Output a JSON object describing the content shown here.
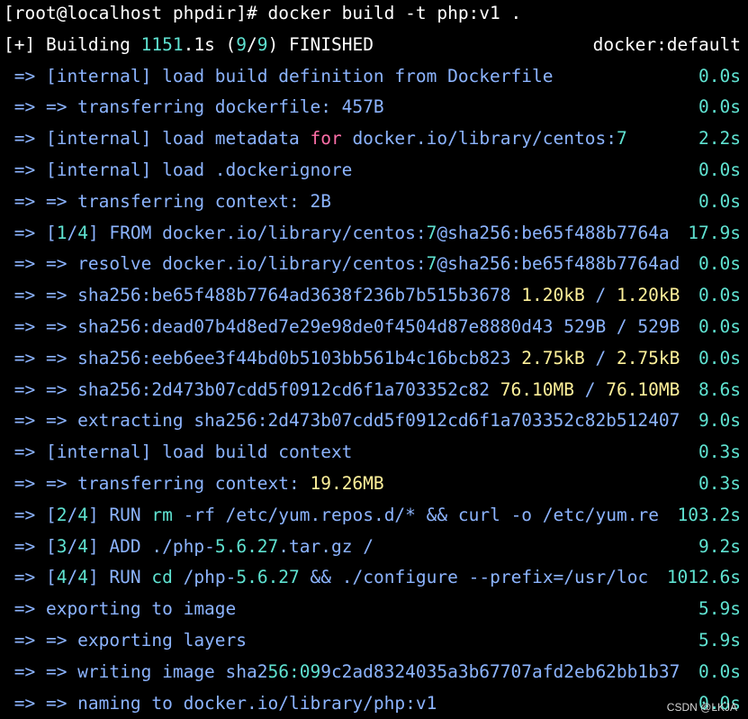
{
  "colors": {
    "default": "#ffffff",
    "blue": "#8cb4ff",
    "cyan": "#5fe2d1",
    "yellow": "#fff19a",
    "pink": "#ff6fa8"
  },
  "watermark": "CSDN @LKJA",
  "lines": [
    {
      "segments": [
        {
          "text": "[root@localhost phpdir]# docker build -t php:v1 .",
          "color": "default"
        }
      ],
      "right": []
    },
    {
      "segments": [
        {
          "text": "[+] Building ",
          "color": "default"
        },
        {
          "text": "1151",
          "color": "cyan"
        },
        {
          "text": ".1s (",
          "color": "default"
        },
        {
          "text": "9",
          "color": "cyan"
        },
        {
          "text": "/",
          "color": "default"
        },
        {
          "text": "9",
          "color": "cyan"
        },
        {
          "text": ") FINISHED",
          "color": "default"
        }
      ],
      "right": [
        {
          "text": "docker:default",
          "color": "default"
        }
      ]
    },
    {
      "segments": [
        {
          "text": " => [internal] load build definition from Dockerfile",
          "color": "blue"
        }
      ],
      "right": [
        {
          "text": "0.0s",
          "color": "cyan"
        }
      ]
    },
    {
      "segments": [
        {
          "text": " => => transferring dockerfile: 457B",
          "color": "blue"
        }
      ],
      "right": [
        {
          "text": "0.0s",
          "color": "cyan"
        }
      ]
    },
    {
      "segments": [
        {
          "text": " => [internal] load metadata ",
          "color": "blue"
        },
        {
          "text": "for",
          "color": "pink"
        },
        {
          "text": " docker.io/library/centos:",
          "color": "blue"
        },
        {
          "text": "7",
          "color": "cyan"
        }
      ],
      "right": [
        {
          "text": "2.2s",
          "color": "cyan"
        }
      ]
    },
    {
      "segments": [
        {
          "text": " => [internal] load .dockerignore",
          "color": "blue"
        }
      ],
      "right": [
        {
          "text": "0.0s",
          "color": "cyan"
        }
      ]
    },
    {
      "segments": [
        {
          "text": " => => transferring context: 2B",
          "color": "blue"
        }
      ],
      "right": [
        {
          "text": "0.0s",
          "color": "cyan"
        }
      ]
    },
    {
      "segments": [
        {
          "text": " => [",
          "color": "blue"
        },
        {
          "text": "1",
          "color": "cyan"
        },
        {
          "text": "/",
          "color": "blue"
        },
        {
          "text": "4",
          "color": "cyan"
        },
        {
          "text": "] FROM docker.io/library/centos:",
          "color": "blue"
        },
        {
          "text": "7",
          "color": "cyan"
        },
        {
          "text": "@sha256:be65f488b7764a",
          "color": "blue"
        }
      ],
      "right": [
        {
          "text": "17.9s",
          "color": "cyan"
        }
      ]
    },
    {
      "segments": [
        {
          "text": " => => resolve docker.io/library/centos:",
          "color": "blue"
        },
        {
          "text": "7",
          "color": "cyan"
        },
        {
          "text": "@sha256:be65f488b7764ad",
          "color": "blue"
        }
      ],
      "right": [
        {
          "text": "0.0s",
          "color": "cyan"
        }
      ]
    },
    {
      "segments": [
        {
          "text": " => => sha256:be65f488b7764ad3638f236b7b515b3678 ",
          "color": "blue"
        },
        {
          "text": "1.20kB",
          "color": "yellow"
        },
        {
          "text": " / ",
          "color": "blue"
        },
        {
          "text": "1.20kB",
          "color": "yellow"
        }
      ],
      "right": [
        {
          "text": "0.0s",
          "color": "cyan"
        }
      ]
    },
    {
      "segments": [
        {
          "text": " => => sha256:dead07b4d8ed7e29e98de0f4504d87e8880d43 529B / 529B",
          "color": "blue"
        }
      ],
      "right": [
        {
          "text": "0.0s",
          "color": "cyan"
        }
      ]
    },
    {
      "segments": [
        {
          "text": " => => sha256:eeb6ee3f44bd0b5103bb561b4c16bcb823 ",
          "color": "blue"
        },
        {
          "text": "2.75kB",
          "color": "yellow"
        },
        {
          "text": " / ",
          "color": "blue"
        },
        {
          "text": "2.75kB",
          "color": "yellow"
        }
      ],
      "right": [
        {
          "text": "0.0s",
          "color": "cyan"
        }
      ]
    },
    {
      "segments": [
        {
          "text": " => => sha256:2d473b07cdd5f0912cd6f1a703352c82 ",
          "color": "blue"
        },
        {
          "text": "76.10MB",
          "color": "yellow"
        },
        {
          "text": " / ",
          "color": "blue"
        },
        {
          "text": "76.10MB",
          "color": "yellow"
        }
      ],
      "right": [
        {
          "text": "8.6s",
          "color": "cyan"
        }
      ]
    },
    {
      "segments": [
        {
          "text": " => => extracting sha256:2d473b07cdd5f0912cd6f1a703352c82b512407",
          "color": "blue"
        }
      ],
      "right": [
        {
          "text": "9.0s",
          "color": "cyan"
        }
      ]
    },
    {
      "segments": [
        {
          "text": " => [internal] load build context",
          "color": "blue"
        }
      ],
      "right": [
        {
          "text": "0.3s",
          "color": "cyan"
        }
      ]
    },
    {
      "segments": [
        {
          "text": " => => transferring context: ",
          "color": "blue"
        },
        {
          "text": "19.26MB",
          "color": "yellow"
        }
      ],
      "right": [
        {
          "text": "0.3s",
          "color": "cyan"
        }
      ]
    },
    {
      "segments": [
        {
          "text": " => [",
          "color": "blue"
        },
        {
          "text": "2",
          "color": "cyan"
        },
        {
          "text": "/",
          "color": "blue"
        },
        {
          "text": "4",
          "color": "cyan"
        },
        {
          "text": "] RUN ",
          "color": "blue"
        },
        {
          "text": "rm",
          "color": "cyan"
        },
        {
          "text": " -rf /etc/yum.repos.d/* && curl -o /etc/yum.re",
          "color": "blue"
        }
      ],
      "right": [
        {
          "text": "103.2s",
          "color": "cyan"
        }
      ]
    },
    {
      "segments": [
        {
          "text": " => [",
          "color": "blue"
        },
        {
          "text": "3",
          "color": "cyan"
        },
        {
          "text": "/",
          "color": "blue"
        },
        {
          "text": "4",
          "color": "cyan"
        },
        {
          "text": "] ADD ./php-",
          "color": "blue"
        },
        {
          "text": "5.6.27",
          "color": "cyan"
        },
        {
          "text": ".tar.gz /",
          "color": "blue"
        }
      ],
      "right": [
        {
          "text": "9.2s",
          "color": "cyan"
        }
      ]
    },
    {
      "segments": [
        {
          "text": " => [",
          "color": "blue"
        },
        {
          "text": "4",
          "color": "cyan"
        },
        {
          "text": "/",
          "color": "blue"
        },
        {
          "text": "4",
          "color": "cyan"
        },
        {
          "text": "] RUN ",
          "color": "blue"
        },
        {
          "text": "cd",
          "color": "cyan"
        },
        {
          "text": " /php-",
          "color": "blue"
        },
        {
          "text": "5.6.27",
          "color": "cyan"
        },
        {
          "text": " && ./configure --prefix=/usr/loc",
          "color": "blue"
        }
      ],
      "right": [
        {
          "text": "1012.6s",
          "color": "cyan"
        }
      ]
    },
    {
      "segments": [
        {
          "text": " => exporting to image",
          "color": "blue"
        }
      ],
      "right": [
        {
          "text": "5.9s",
          "color": "cyan"
        }
      ]
    },
    {
      "segments": [
        {
          "text": " => => exporting layers",
          "color": "blue"
        }
      ],
      "right": [
        {
          "text": "5.9s",
          "color": "cyan"
        }
      ]
    },
    {
      "segments": [
        {
          "text": " => => writing image sha2",
          "color": "blue"
        },
        {
          "text": "56:09",
          "color": "cyan"
        },
        {
          "text": "9c2ad8324035a3b67707afd2eb62bb1b37",
          "color": "blue"
        }
      ],
      "right": [
        {
          "text": "0.0s",
          "color": "cyan"
        }
      ]
    },
    {
      "segments": [
        {
          "text": " => => naming to docker.io/library/php:v1",
          "color": "blue"
        }
      ],
      "right": [
        {
          "text": "0.0s",
          "color": "cyan"
        }
      ]
    }
  ]
}
